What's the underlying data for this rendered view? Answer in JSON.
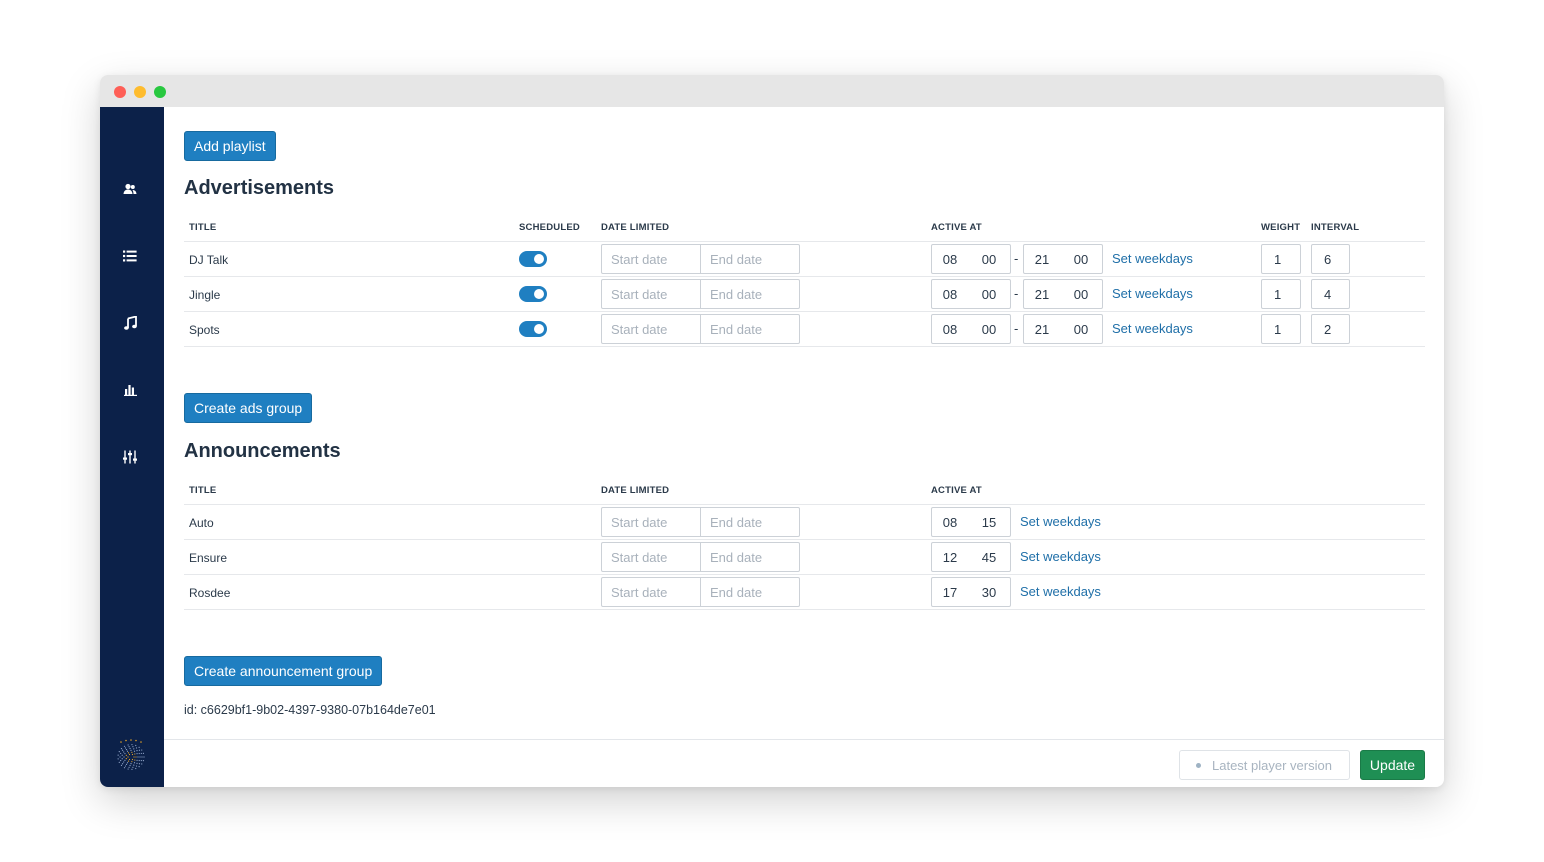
{
  "toolbar": {
    "add_playlist_label": "Add playlist"
  },
  "advertisements": {
    "heading": "Advertisements",
    "columns": {
      "title": "TITLE",
      "scheduled": "SCHEDULED",
      "date_limited": "DATE LIMITED",
      "active_at": "ACTIVE AT",
      "weight": "WEIGHT",
      "interval": "INTERVAL"
    },
    "rows": [
      {
        "title": "DJ Talk",
        "scheduled": true,
        "start_placeholder": "Start date",
        "end_placeholder": "End date",
        "from_h": "08",
        "from_m": "00",
        "to_h": "21",
        "to_m": "00",
        "weekdays_label": "Set weekdays",
        "weight": "1",
        "interval": "6"
      },
      {
        "title": "Jingle",
        "scheduled": true,
        "start_placeholder": "Start date",
        "end_placeholder": "End date",
        "from_h": "08",
        "from_m": "00",
        "to_h": "21",
        "to_m": "00",
        "weekdays_label": "Set weekdays",
        "weight": "1",
        "interval": "4"
      },
      {
        "title": "Spots",
        "scheduled": true,
        "start_placeholder": "Start date",
        "end_placeholder": "End date",
        "from_h": "08",
        "from_m": "00",
        "to_h": "21",
        "to_m": "00",
        "weekdays_label": "Set weekdays",
        "weight": "1",
        "interval": "2"
      }
    ],
    "create_group_label": "Create ads group"
  },
  "announcements": {
    "heading": "Announcements",
    "columns": {
      "title": "TITLE",
      "date_limited": "DATE LIMITED",
      "active_at": "ACTIVE AT"
    },
    "rows": [
      {
        "title": "Auto",
        "start_placeholder": "Start date",
        "end_placeholder": "End date",
        "h": "08",
        "m": "15",
        "weekdays_label": "Set weekdays"
      },
      {
        "title": "Ensure",
        "start_placeholder": "Start date",
        "end_placeholder": "End date",
        "h": "12",
        "m": "45",
        "weekdays_label": "Set weekdays"
      },
      {
        "title": "Rosdee",
        "start_placeholder": "Start date",
        "end_placeholder": "End date",
        "h": "17",
        "m": "30",
        "weekdays_label": "Set weekdays"
      }
    ],
    "create_group_label": "Create announcement group"
  },
  "id_text": "id: c6629bf1-9b02-4397-9380-07b164de7e01",
  "footer": {
    "version_label": "Latest player version",
    "update_label": "Update"
  },
  "sidebar": {
    "icons": [
      "users-icon",
      "list-icon",
      "music-note-icon",
      "bar-chart-icon",
      "sliders-icon",
      "logo-icon"
    ]
  },
  "colors": {
    "sidebar_bg": "#0c2149",
    "primary": "#1f7fc1",
    "success": "#1f8f54",
    "link": "#1f6fa8"
  }
}
